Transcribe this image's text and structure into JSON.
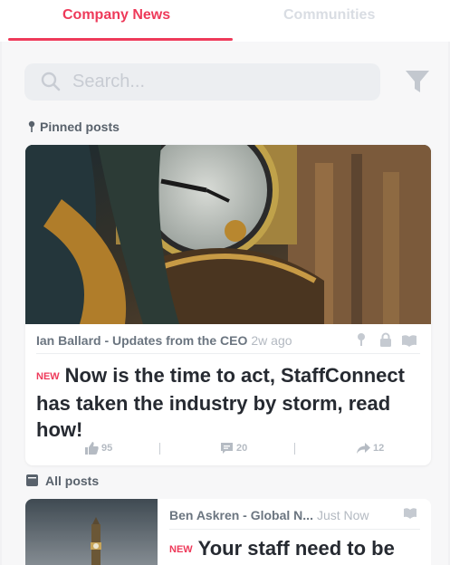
{
  "tabs": {
    "company_news": "Company News",
    "communities": "Communities"
  },
  "search": {
    "placeholder": "Search...",
    "icon": "search-icon",
    "filter_icon": "filter-icon"
  },
  "sections": {
    "pinned": "Pinned posts",
    "all": "All posts"
  },
  "pinned_post": {
    "author_line": "Ian Ballard - Updates from the CEO",
    "time": "2w ago",
    "badge": "NEW",
    "headline": "Now is the time to act, StaffConnect has taken the industry by storm, read how!",
    "likes": "95",
    "comments": "20",
    "shares": "12",
    "icons": [
      "pin-icon",
      "lock-icon",
      "book-icon"
    ]
  },
  "post_2": {
    "author_line": "Ben Askren - Global N...",
    "time": "Just Now",
    "badge": "NEW",
    "headline": "Your staff need to be"
  },
  "colors": {
    "accent": "#ee3a5a",
    "muted_text": "#6b7580",
    "headline": "#262a31",
    "background": "#f7f7f8"
  }
}
